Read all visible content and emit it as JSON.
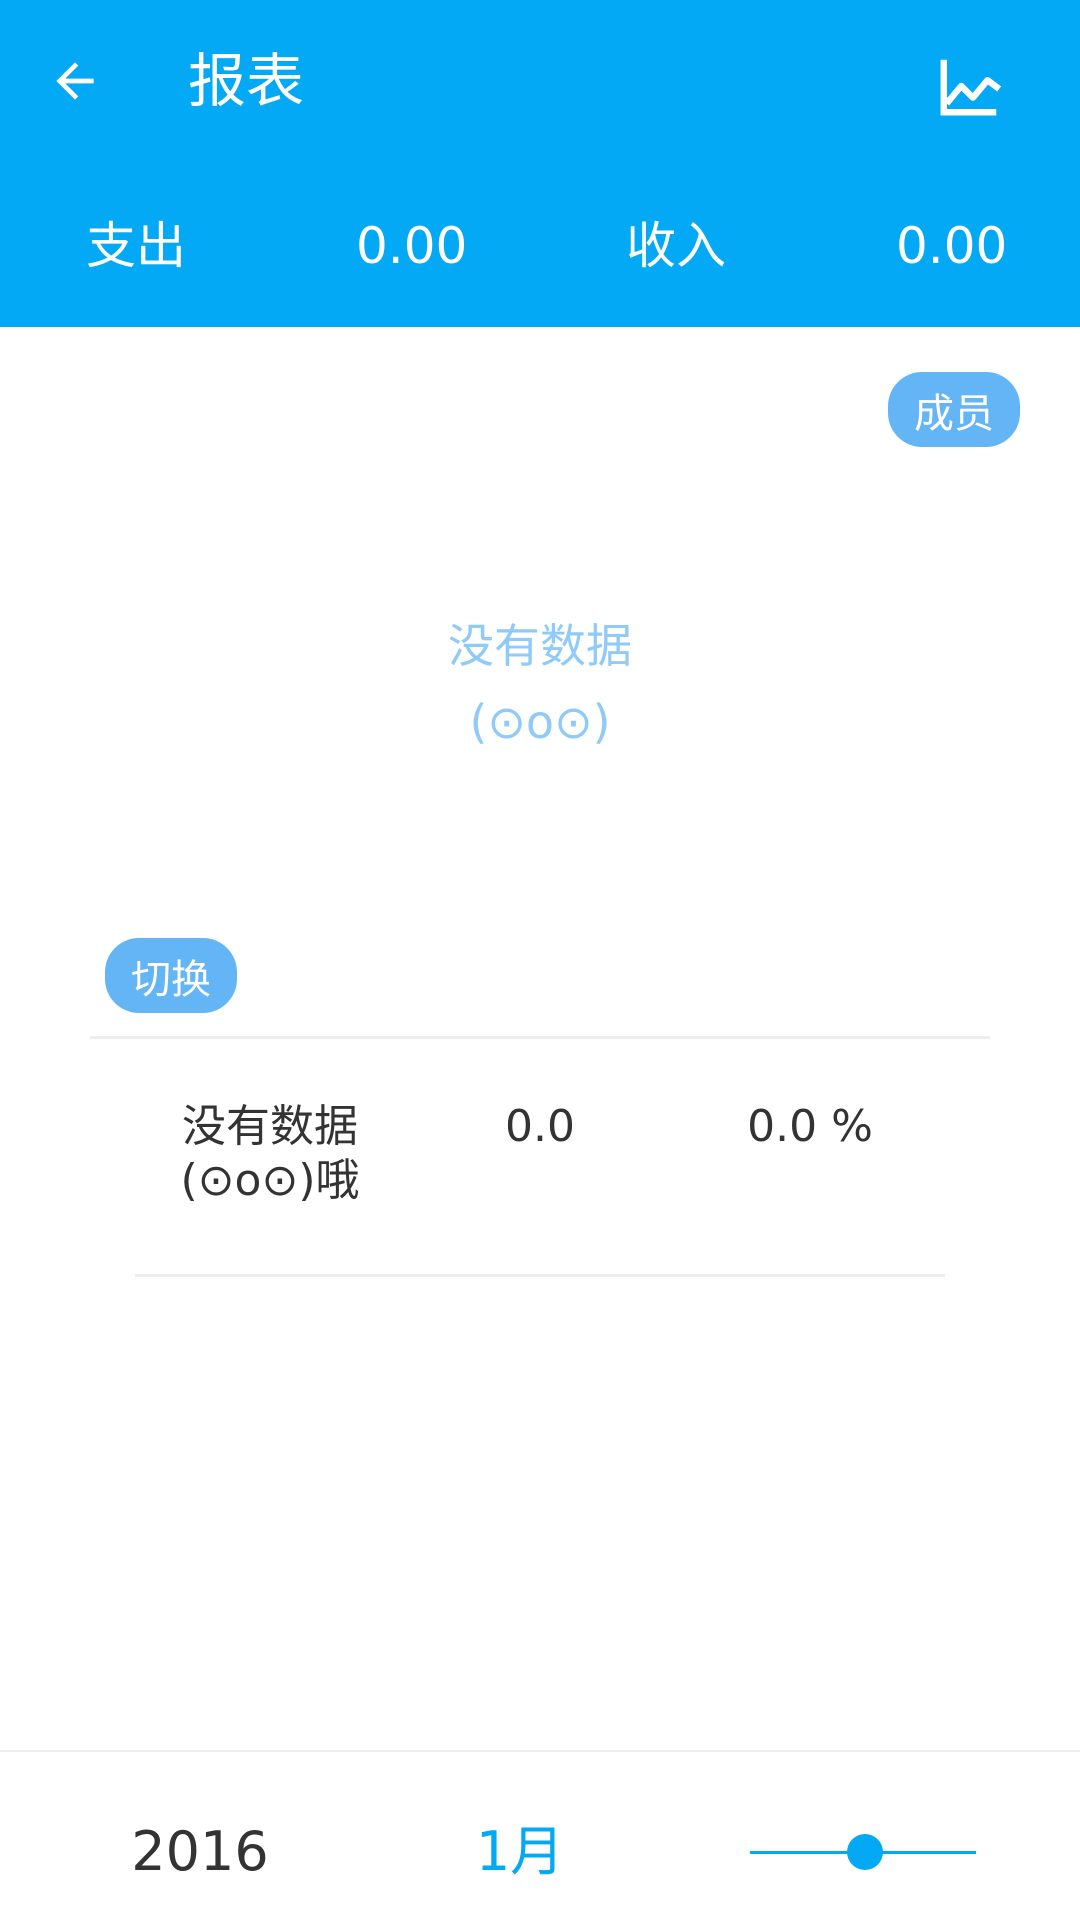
{
  "toolbar": {
    "title": "报表",
    "back_icon": "arrow-left-icon",
    "chart_icon": "line-chart-icon"
  },
  "summary": {
    "expense_label": "支出",
    "expense_value": "0.00",
    "income_label": "收入",
    "income_value": "0.00"
  },
  "chart": {
    "member_button": "成员",
    "empty_line1": "没有数据",
    "empty_line2": "(⊙o⊙)",
    "switch_button": "切换"
  },
  "table": {
    "rows": [
      {
        "name_line1": "没有数据",
        "name_line2": "(⊙o⊙)哦",
        "amount": "0.0",
        "percent": "0.0 %"
      }
    ]
  },
  "footer": {
    "year": "2016",
    "month": "1月",
    "slider_fraction": 0.5
  },
  "colors": {
    "primary": "#03A9F4",
    "chip": "#64B5F6",
    "empty_text": "#90CAF9",
    "body_text": "#333333"
  }
}
